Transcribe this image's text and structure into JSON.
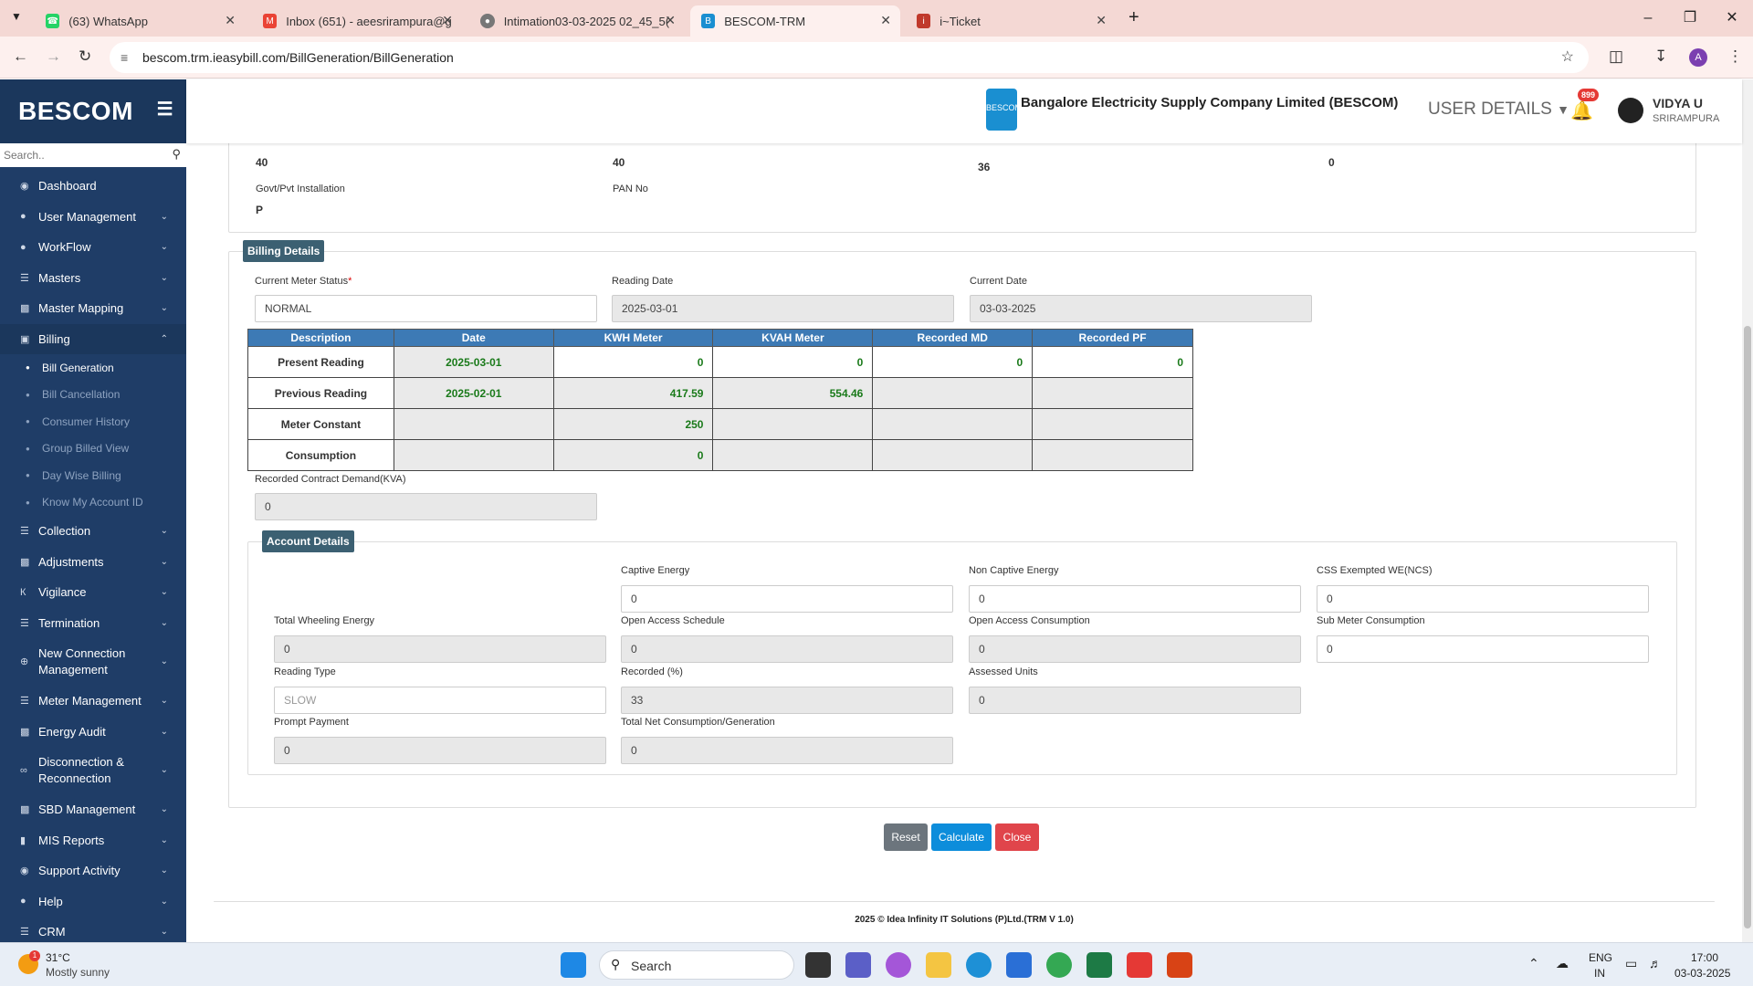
{
  "browser": {
    "tabs": [
      {
        "title": "(63) WhatsApp",
        "color": "#25d366"
      },
      {
        "title": "Inbox (651) - aeesrirampura@g",
        "color": "#ea4335"
      },
      {
        "title": "Intimation03-03-2025 02_45_5(",
        "color": "#777777"
      },
      {
        "title": "BESCOM-TRM",
        "color": "#1a8fd1"
      },
      {
        "title": "i~Ticket",
        "color": "#c0392b"
      }
    ],
    "url": "bescom.trm.ieasybill.com/BillGeneration/BillGeneration"
  },
  "sidebar": {
    "brand": "BESCOM",
    "search_placeholder": "Search..",
    "items": [
      {
        "label": "Dashboard",
        "icon": "dashboard-icon"
      },
      {
        "label": "User Management",
        "icon": "users-icon"
      },
      {
        "label": "WorkFlow",
        "icon": "user-icon"
      },
      {
        "label": "Masters",
        "icon": "list-icon"
      },
      {
        "label": "Master Mapping",
        "icon": "sitemap-icon"
      },
      {
        "label": "Billing",
        "icon": "monitor-icon"
      },
      {
        "label": "Collection",
        "icon": "list-icon"
      },
      {
        "label": "Adjustments",
        "icon": "sitemap-icon"
      },
      {
        "label": "Vigilance",
        "icon": "vk-icon"
      },
      {
        "label": "Termination",
        "icon": "list-icon"
      },
      {
        "label": "New Connection Management",
        "icon": "plus-circle-icon"
      },
      {
        "label": "Meter Management",
        "icon": "list-icon"
      },
      {
        "label": "Energy Audit",
        "icon": "sitemap-icon"
      },
      {
        "label": "Disconnection & Reconnection",
        "icon": "link-icon"
      },
      {
        "label": "SBD Management",
        "icon": "sitemap-icon"
      },
      {
        "label": "MIS Reports",
        "icon": "bar-chart-icon"
      },
      {
        "label": "Support Activity",
        "icon": "headset-icon"
      },
      {
        "label": "Help",
        "icon": "help-icon"
      },
      {
        "label": "CRM",
        "icon": "list-icon"
      }
    ],
    "billing_sub": [
      "Bill Generation",
      "Bill Cancellation",
      "Consumer History",
      "Group Billed View",
      "Day Wise Billing",
      "Know My Account ID"
    ]
  },
  "header": {
    "company": "Bangalore Electricity Supply Company Limited (BESCOM)",
    "logo_text": "BESCOM",
    "user_details": "USER DETAILS",
    "notif_count": "899",
    "user_name": "VIDYA U",
    "user_location": "SRIRAMPURA"
  },
  "top_section": {
    "values": [
      "40",
      "40",
      "36",
      "0"
    ],
    "govt_label": "Govt/Pvt Installation",
    "govt_value": "P",
    "pan_label": "PAN No"
  },
  "billing": {
    "legend": "Billing Details",
    "meter_status_label": "Current Meter Status",
    "required_mark": "*",
    "meter_status_value": "NORMAL",
    "reading_date_label": "Reading Date",
    "reading_date_value": "2025-03-01",
    "current_date_label": "Current Date",
    "current_date_value": "03-03-2025",
    "table_headers": [
      "Description",
      "Date",
      "KWH Meter",
      "KVAH Meter",
      "Recorded MD",
      "Recorded PF"
    ],
    "rows": [
      {
        "desc": "Present Reading",
        "date": "2025-03-01",
        "kwh": "0",
        "kvah": "0",
        "md": "0",
        "pf": "0"
      },
      {
        "desc": "Previous Reading",
        "date": "2025-02-01",
        "kwh": "417.59",
        "kvah": "554.46",
        "md": "",
        "pf": ""
      },
      {
        "desc": "Meter Constant",
        "date": "",
        "kwh": "250",
        "kvah": "",
        "md": "",
        "pf": ""
      },
      {
        "desc": "Consumption",
        "date": "",
        "kwh": "0",
        "kvah": "",
        "md": "",
        "pf": ""
      }
    ],
    "rcd_label": "Recorded Contract Demand(KVA)",
    "rcd_value": "0"
  },
  "account": {
    "legend": "Account Details",
    "captive_energy_label": "Captive Energy",
    "captive_energy": "0",
    "non_captive_label": "Non Captive Energy",
    "non_captive": "0",
    "css_label": "CSS Exempted WE(NCS)",
    "css": "0",
    "total_wheeling_label": "Total Wheeling Energy",
    "total_wheeling": "0",
    "oa_schedule_label": "Open Access Schedule",
    "oa_schedule": "0",
    "oa_consumption_label": "Open Access Consumption",
    "oa_consumption": "0",
    "sub_meter_label": "Sub Meter Consumption",
    "sub_meter": "0",
    "reading_type_label": "Reading Type",
    "reading_type": "SLOW",
    "recorded_pct_label": "Recorded (%)",
    "recorded_pct": "33",
    "assessed_label": "Assessed Units",
    "assessed": "0",
    "prompt_label": "Prompt Payment",
    "prompt": "0",
    "total_net_label": "Total Net Consumption/Generation",
    "total_net": "0"
  },
  "buttons": {
    "reset": "Reset",
    "calculate": "Calculate",
    "close": "Close"
  },
  "footer": "2025 © Idea Infinity IT Solutions (P)Ltd.(TRM V 1.0)",
  "taskbar": {
    "weather_temp": "31°C",
    "weather_desc": "Mostly sunny",
    "weather_badge": "1",
    "search_placeholder": "Search",
    "lang": "ENG",
    "region": "IN",
    "time": "17:00",
    "date": "03-03-2025"
  }
}
